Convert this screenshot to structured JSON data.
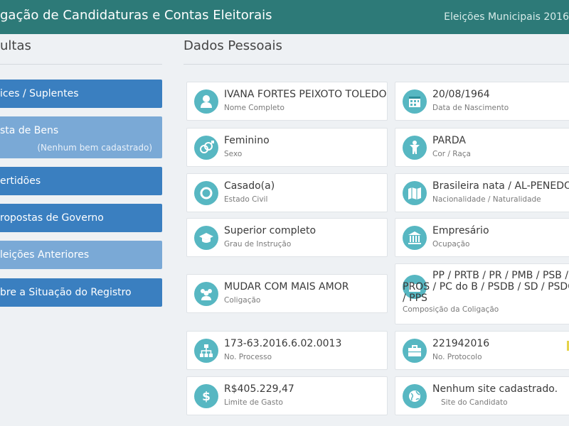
{
  "header": {
    "title": "gação de Candidaturas e Contas Eleitorais",
    "subtitle": "Eleições Municipais 2016"
  },
  "sidebar": {
    "title": "ultas",
    "items": [
      {
        "label": "ices / Suplentes"
      },
      {
        "label": "sta de Bens",
        "note": "(Nenhum bem cadastrado)"
      },
      {
        "label": "ertidões"
      },
      {
        "label": "ropostas de Governo"
      },
      {
        "label": "leições Anteriores"
      },
      {
        "label": "bre a Situação do Registro"
      }
    ]
  },
  "main": {
    "title": "Dados Pessoais",
    "cards": {
      "nome": {
        "value": "IVANA FORTES PEIXOTO TOLEDO",
        "label": "Nome Completo",
        "icon": "person-icon"
      },
      "nascimento": {
        "value": "20/08/1964",
        "label": "Data de Nascimento",
        "icon": "calendar-icon"
      },
      "sexo": {
        "value": "Feminino",
        "label": "Sexo",
        "icon": "gender-icon"
      },
      "cor": {
        "value": "PARDA",
        "label": "Cor / Raça",
        "icon": "figure-icon"
      },
      "estado_civil": {
        "value": "Casado(a)",
        "label": "Estado Civil",
        "icon": "ring-icon"
      },
      "nacionalidade": {
        "value": "Brasileira nata / AL-PENEDO",
        "label": "Nacionalidade / Naturalidade",
        "icon": "map-icon"
      },
      "instrucao": {
        "value": "Superior completo",
        "label": "Grau de Instrução",
        "icon": "graduation-cap-icon"
      },
      "ocupacao": {
        "value": "Empresário",
        "label": "Ocupação",
        "icon": "building-icon"
      },
      "coligacao": {
        "value": "MUDAR COM MAIS AMOR",
        "label": "Coligação",
        "icon": "group-icon"
      },
      "composicao": {
        "value": "PP / PRTB / PR / PMB / PSB / PROS / PC do B / PSDB / SD / PSDC / PPS",
        "label": "Composição da Coligação",
        "icon": "folder-icon"
      },
      "processo": {
        "value": "173-63.2016.6.02.0013",
        "label": "No. Processo",
        "icon": "sitemap-icon"
      },
      "protocolo": {
        "value": "221942016",
        "label": "No. Protocolo",
        "icon": "briefcase-icon"
      },
      "limite": {
        "value": "R$405.229,47",
        "label": "Limite de Gasto",
        "icon": "dollar-icon"
      },
      "site": {
        "value": "Nenhum site cadastrado.",
        "label": "Site do Candidato",
        "icon": "globe-icon"
      }
    }
  },
  "colors": {
    "header": "#2d7a78",
    "menu": "#3a7fc0",
    "menu_light": "#7aa9d6",
    "icon": "#57b7c2"
  }
}
